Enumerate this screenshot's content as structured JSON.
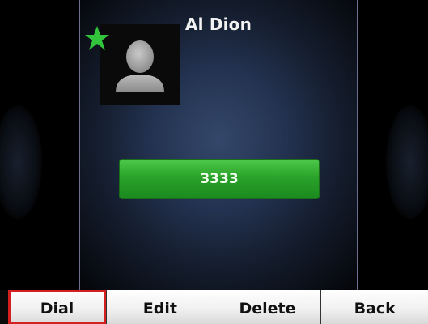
{
  "contact": {
    "name": "Al Dion",
    "number": "3333",
    "favorite": true
  },
  "softkeys": [
    {
      "label": "Dial",
      "selected": true
    },
    {
      "label": "Edit",
      "selected": false
    },
    {
      "label": "Delete",
      "selected": false
    },
    {
      "label": "Back",
      "selected": false
    }
  ],
  "colors": {
    "favorite_star": "#32c43a",
    "number_button": "#2aa22a",
    "selection_outline": "#d42020",
    "panel_divider": "#6e6e92"
  },
  "icons": {
    "avatar": "person-silhouette-icon",
    "favorite": "star-icon"
  }
}
